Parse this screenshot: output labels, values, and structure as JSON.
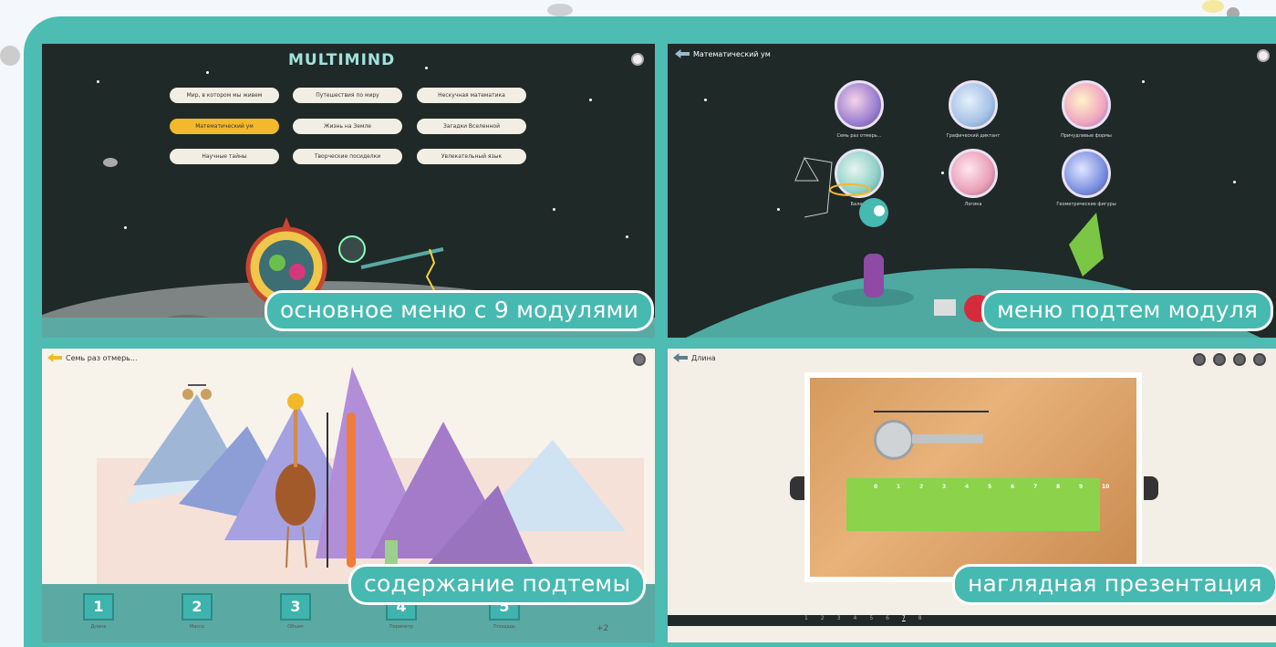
{
  "captions": {
    "main_menu": "основное меню с 9 модулями",
    "submenu": "меню подтем модуля",
    "content": "содержание подтемы",
    "presentation": "наглядная презентация"
  },
  "panel1": {
    "logo": "MULTIMIND",
    "modules": [
      "Мир, в котором мы живем",
      "Путешествия по миру",
      "Нескучная математика",
      "Математический ум",
      "Жизнь на Земле",
      "Загадки Вселенной",
      "Научные тайны",
      "Творческие посиделки",
      "Увлекательный язык"
    ]
  },
  "panel2": {
    "title": "Математический ум",
    "topics": [
      "Семь раз отмерь...",
      "Графический диктант",
      "Причудливые формы",
      "Баланс",
      "Логика",
      "Геометрические фигуры"
    ]
  },
  "panel3": {
    "title": "Семь раз отмерь...",
    "steps": [
      {
        "num": "1",
        "label": "Длина"
      },
      {
        "num": "2",
        "label": "Масса"
      },
      {
        "num": "3",
        "label": "Объем"
      },
      {
        "num": "4",
        "label": "Периметр"
      },
      {
        "num": "5",
        "label": "Площадь"
      }
    ],
    "more": "+2"
  },
  "panel4": {
    "title": "Длина",
    "ruler_ticks": [
      "0",
      "1",
      "2",
      "3",
      "4",
      "5",
      "6",
      "7",
      "8",
      "9",
      "10"
    ],
    "pager": [
      "1",
      "2",
      "3",
      "4",
      "5",
      "6",
      "7",
      "8"
    ]
  },
  "colors": {
    "frame": "#4dbcb2",
    "caption_bg": "#46b9b0",
    "active_module": "#f2b92a"
  }
}
